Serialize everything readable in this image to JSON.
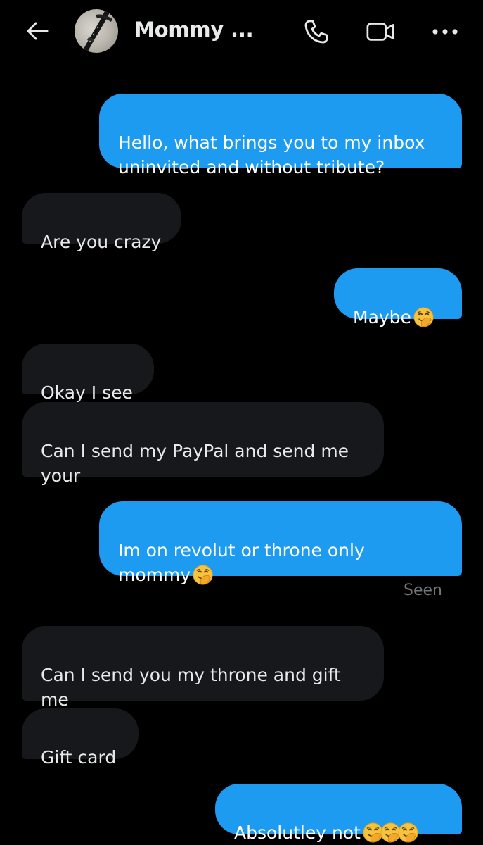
{
  "header": {
    "title": "Mommy ..."
  },
  "messages": [
    {
      "id": "m1",
      "side": "sent",
      "text": "Hello, what brings you to my inbox\nuninvited and without tribute?",
      "emoji": []
    },
    {
      "id": "m2",
      "side": "received",
      "text": "Are you crazy",
      "emoji": []
    },
    {
      "id": "m3",
      "side": "sent",
      "text": "Maybe",
      "emoji": [
        "face-with-hand-over-mouth"
      ]
    },
    {
      "id": "m4",
      "side": "received",
      "text": "Okay I see",
      "emoji": []
    },
    {
      "id": "m5",
      "side": "received",
      "text": "Can I send my PayPal and send me\nyour",
      "emoji": []
    },
    {
      "id": "m6",
      "side": "sent",
      "text": "Im on revolut or throne only\nmommy",
      "emoji": [
        "face-with-hand-over-mouth"
      ]
    },
    {
      "id": "m7",
      "side": "received",
      "text": "Can I send you my throne and gift\nme",
      "emoji": []
    },
    {
      "id": "m8",
      "side": "received",
      "text": "Gift card",
      "emoji": []
    },
    {
      "id": "m9",
      "side": "sent",
      "text": "Absolutley not",
      "emoji": [
        "face-with-hand-over-mouth",
        "face-with-hand-over-mouth",
        "face-with-hand-over-mouth"
      ]
    }
  ],
  "read_receipt": "Seen",
  "colors": {
    "background": "#000000",
    "sent_bubble": "#1d9bf0",
    "received_bubble": "#16181c",
    "text_primary": "#e7e9ea",
    "text_secondary": "#71767b"
  },
  "icons": {
    "back": "arrow-left-icon",
    "call": "phone-icon",
    "video": "video-camera-icon",
    "more": "more-dots-icon"
  }
}
